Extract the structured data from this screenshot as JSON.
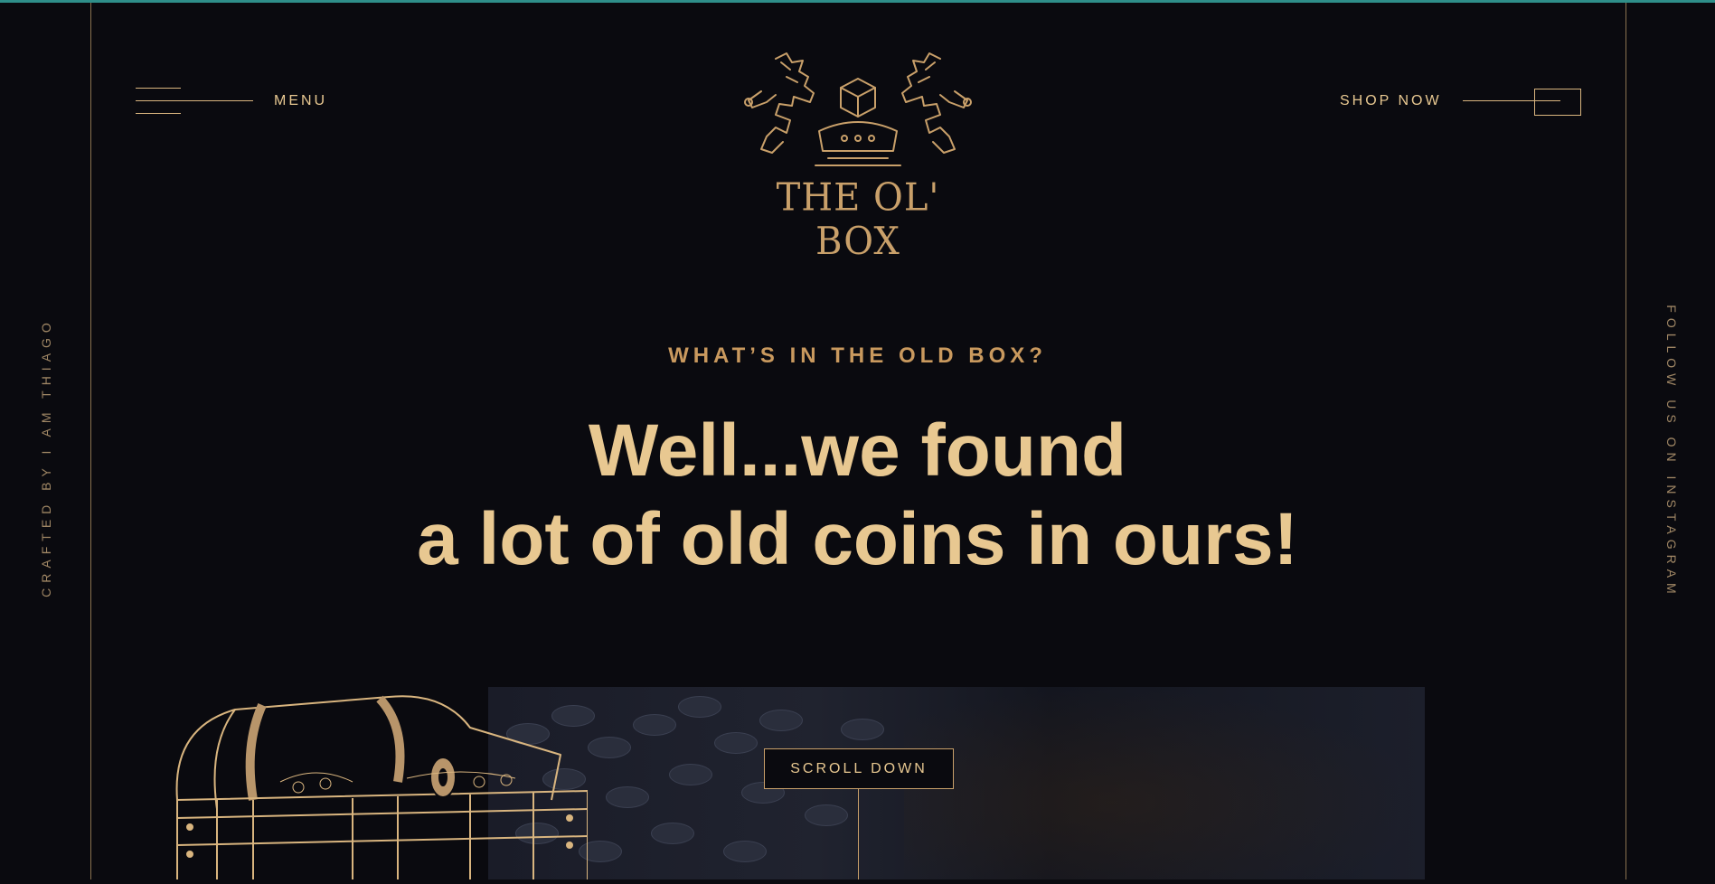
{
  "nav": {
    "menu_label": "MENU",
    "shop_label": "SHOP NOW"
  },
  "brand": {
    "name": "THE OL' BOX"
  },
  "hero": {
    "eyebrow": "WHAT’S IN THE OLD BOX?",
    "headline_line1": "Well...we found",
    "headline_line2": "a lot of old coins in ours!",
    "scroll_label": "SCROLL DOWN"
  },
  "side": {
    "left_text": "CRAFTED BY I AM THIAGO",
    "right_text": "FOLLOW US ON INSTAGRAM"
  },
  "colors": {
    "background": "#0a0a0f",
    "gold": "#e8c891",
    "gold_dark": "#c9995e",
    "accent_bar": "#2f8f8a"
  },
  "icons": {
    "menu": "hamburger-lines-icon",
    "shop": "arrow-box-icon",
    "logo": "lion-crest-icon",
    "illustration": "treasure-chest-illustration"
  }
}
